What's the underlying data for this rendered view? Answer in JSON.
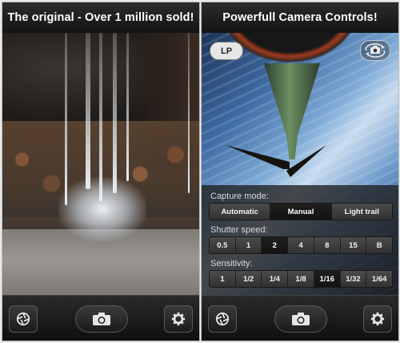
{
  "left_panel": {
    "title": "The original - Over 1 million sold!"
  },
  "right_panel": {
    "title": "Powerfull Camera Controls!",
    "badge": "LP",
    "capture_mode": {
      "label": "Capture mode:",
      "options": [
        "Automatic",
        "Manual",
        "Light trail"
      ],
      "selected": "Manual"
    },
    "shutter_speed": {
      "label": "Shutter speed:",
      "options": [
        "0.5",
        "1",
        "2",
        "4",
        "8",
        "15",
        "B"
      ],
      "selected": "2"
    },
    "sensitivity": {
      "label": "Sensitivity:",
      "options": [
        "1",
        "1/2",
        "1/4",
        "1/8",
        "1/16",
        "1/32",
        "1/64"
      ],
      "selected": "1/16"
    }
  },
  "toolbar": {
    "icons": [
      "aperture-icon",
      "camera-icon",
      "gear-icon"
    ]
  }
}
